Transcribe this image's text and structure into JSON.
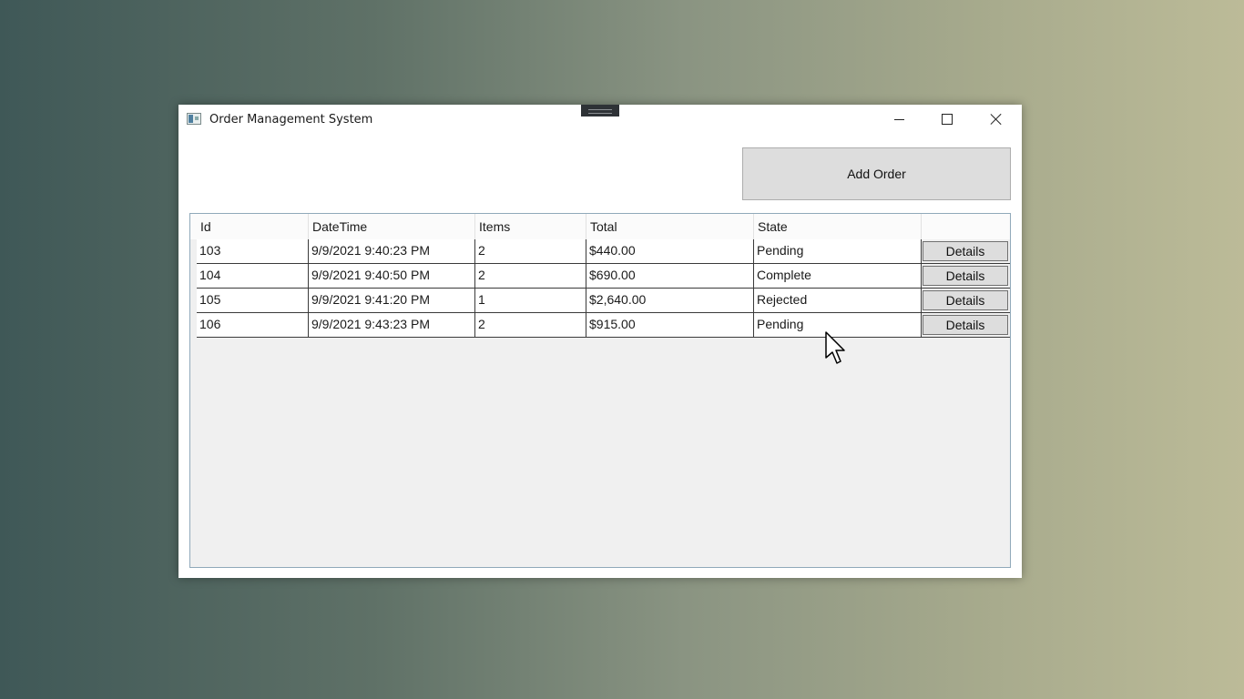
{
  "window": {
    "title": "Order Management System"
  },
  "toolbar": {
    "add_order_label": "Add Order"
  },
  "grid": {
    "columns": [
      "Id",
      "DateTime",
      "Items",
      "Total",
      "State",
      ""
    ],
    "rows": [
      {
        "id": "103",
        "datetime": "9/9/2021 9:40:23 PM",
        "items": "2",
        "total": "$440.00",
        "state": "Pending",
        "action": "Details"
      },
      {
        "id": "104",
        "datetime": "9/9/2021 9:40:50 PM",
        "items": "2",
        "total": "$690.00",
        "state": "Complete",
        "action": "Details"
      },
      {
        "id": "105",
        "datetime": "9/9/2021 9:41:20 PM",
        "items": "1",
        "total": "$2,640.00",
        "state": "Rejected",
        "action": "Details"
      },
      {
        "id": "106",
        "datetime": "9/9/2021 9:43:23 PM",
        "items": "2",
        "total": "$915.00",
        "state": "Pending",
        "action": "Details"
      }
    ]
  },
  "icons": {
    "app": "app-window-icon",
    "minimize": "minimize-icon",
    "maximize": "maximize-icon",
    "close": "close-icon",
    "cursor": "mouse-pointer-icon"
  }
}
